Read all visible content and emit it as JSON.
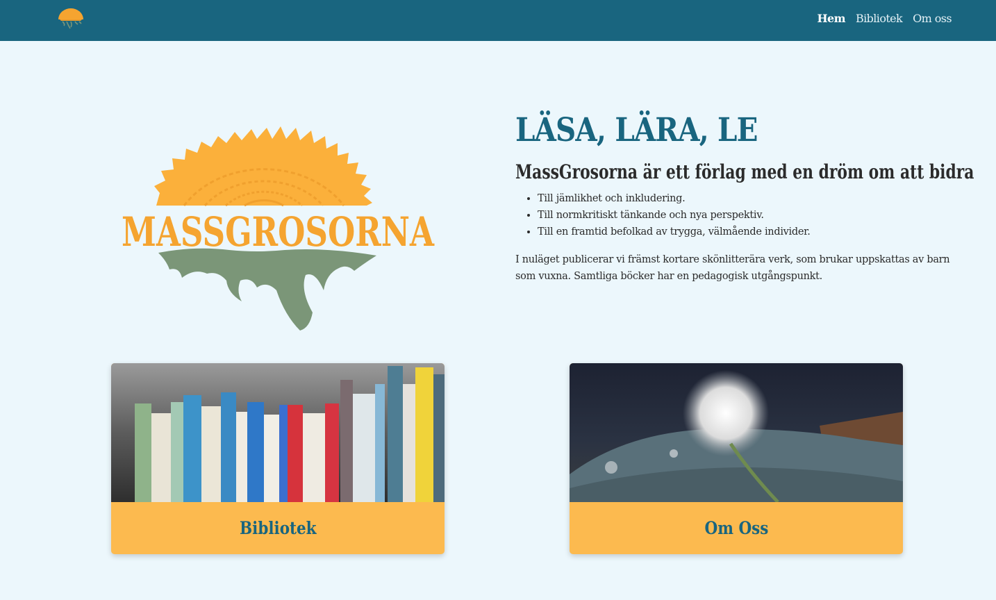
{
  "nav": {
    "logo_icon": "sun-dandelion-logo-icon",
    "links": [
      {
        "label": "Hem",
        "active": true
      },
      {
        "label": "Bibliotek",
        "active": false
      },
      {
        "label": "Om oss",
        "active": false
      }
    ]
  },
  "hero": {
    "logo_text": "MASSGROSORNA",
    "title": "LÄSA, LÄRA, LE",
    "subtitle": "MassGrosorna är ett förlag med en dröm om att bidra",
    "bullets": [
      "Till jämlikhet och inkludering.",
      "Till normkritiskt tänkande och nya perspektiv.",
      "Till en framtid befolkad av trygga, välmående individer."
    ],
    "body": "I nuläget publicerar vi främst kortare skönlitterära verk, som brukar uppskattas av barn som vuxna. Samtliga böcker har en pedagogisk utgångspunkt."
  },
  "cards": [
    {
      "title": "Bibliotek",
      "image": "books-spines-photo"
    },
    {
      "title": "Om Oss",
      "image": "dandelion-on-book-photo"
    }
  ],
  "colors": {
    "navbar": "#19657f",
    "background": "#ecf7fc",
    "accent": "#fcba4f",
    "logo_orange": "#f5a430",
    "logo_green": "#7b9678"
  }
}
